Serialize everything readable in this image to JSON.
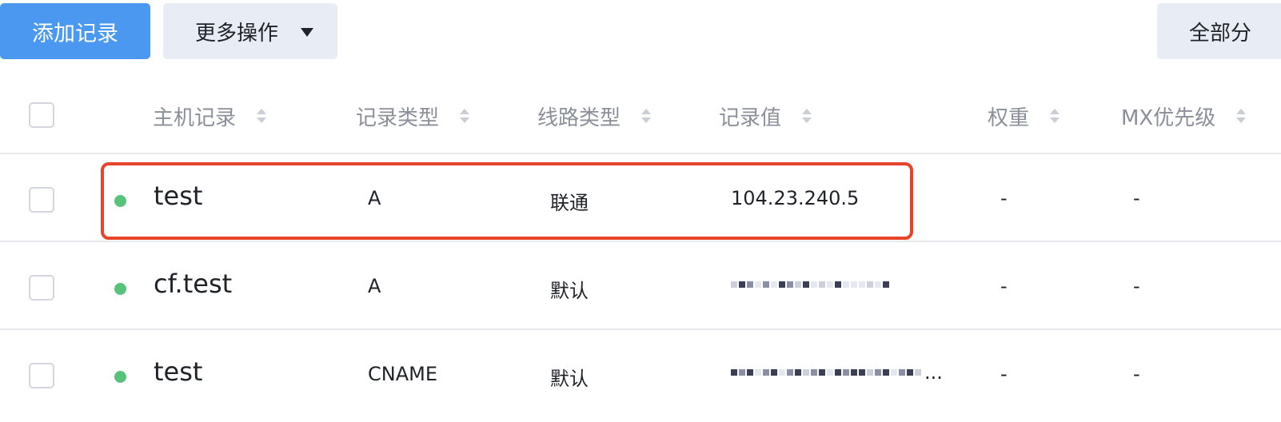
{
  "toolbar": {
    "add_record": "添加记录",
    "more_actions": "更多操作",
    "filter_all": "全部分"
  },
  "table": {
    "columns": [
      "主机记录",
      "记录类型",
      "线路类型",
      "记录值",
      "权重",
      "MX优先级"
    ],
    "rows": [
      {
        "host": "test",
        "type": "A",
        "line": "联通",
        "value": "104.23.240.5",
        "weight": "-",
        "mx": "-",
        "status": "enabled",
        "value_obscured": false,
        "highlighted": true
      },
      {
        "host": "cf.test",
        "type": "A",
        "line": "默认",
        "value": "",
        "weight": "-",
        "mx": "-",
        "status": "enabled",
        "value_obscured": true
      },
      {
        "host": "test",
        "type": "CNAME",
        "line": "默认",
        "value": "",
        "value_suffix": "...",
        "weight": "-",
        "mx": "-",
        "status": "enabled",
        "value_obscured": true
      }
    ]
  },
  "colors": {
    "primary": "#4b98f0",
    "status_enabled": "#57c27a",
    "highlight_border": "#e8432b"
  }
}
